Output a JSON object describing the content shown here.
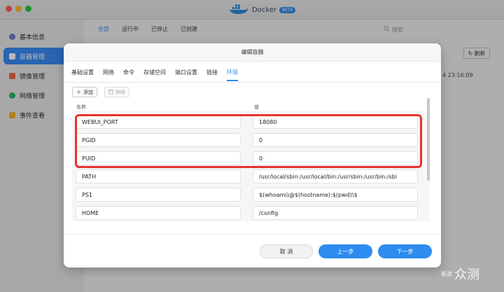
{
  "app": {
    "name": "Docker",
    "badge": "BETA"
  },
  "sidebar": {
    "items": [
      {
        "label": "基本信息",
        "icon": "gear-icon",
        "color": "#6a7fd6"
      },
      {
        "label": "容器管理",
        "icon": "container-icon",
        "color": "#ffffff",
        "active": true
      },
      {
        "label": "镜像管理",
        "icon": "image-icon",
        "color": "#ef6b4a"
      },
      {
        "label": "网络管理",
        "icon": "network-icon",
        "color": "#2fb36b"
      },
      {
        "label": "事件查看",
        "icon": "event-icon",
        "color": "#f0b42a"
      }
    ]
  },
  "background": {
    "filters": [
      "全部",
      "运行中",
      "已停止",
      "已创建"
    ],
    "search_placeholder": "搜索",
    "refresh_label": "刷新",
    "timestamp": "4 23:16:09"
  },
  "modal": {
    "title": "编辑容器",
    "tabs": [
      "基础设置",
      "网络",
      "命令",
      "存储空间",
      "端口设置",
      "链接",
      "环境"
    ],
    "active_tab": 6,
    "add_label": "添加",
    "remove_label": "移除",
    "col_name": "名称",
    "col_value": "值",
    "rows": [
      {
        "name": "WEBUI_PORT",
        "value": "18080"
      },
      {
        "name": "PGID",
        "value": "0"
      },
      {
        "name": "PUID",
        "value": "0"
      },
      {
        "name": "PATH",
        "value": "/usr/local/sbin:/usr/local/bin:/usr/sbin:/usr/bin:/sbi"
      },
      {
        "name": "PS1",
        "value": "$(whoami)@$(hostname):$(pwd)\\$"
      },
      {
        "name": "HOME",
        "value": "/config"
      }
    ],
    "cancel_label": "取 消",
    "prev_label": "上一步",
    "next_label": "下一步"
  },
  "watermark": {
    "text": "众测",
    "small": "新浪"
  },
  "colors": {
    "accent": "#2d8cf0",
    "highlight": "#e8332a"
  }
}
